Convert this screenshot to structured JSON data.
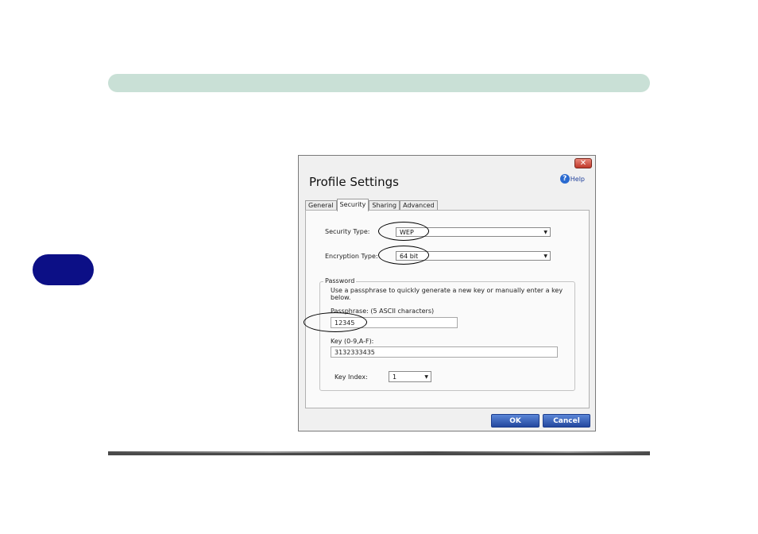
{
  "dialog": {
    "title": "Profile Settings",
    "close_glyph": "✕",
    "help_label": "Help",
    "help_glyph": "?"
  },
  "tabs": [
    {
      "label": "General",
      "active": false
    },
    {
      "label": "Security",
      "active": true
    },
    {
      "label": "Sharing",
      "active": false
    },
    {
      "label": "Advanced",
      "active": false
    }
  ],
  "security": {
    "security_type_label": "Security Type:",
    "security_type_value": "WEP",
    "encryption_type_label": "Encryption Type:",
    "encryption_type_value": "64 bit"
  },
  "password": {
    "group_title": "Password",
    "hint": "Use a passphrase to quickly generate a new key or manually enter a key below.",
    "passphrase_label": "Passphrase: (5 ASCII characters)",
    "passphrase_value": "12345",
    "key_label": "Key (0-9,A-F):",
    "key_value": "3132333435",
    "key_index_label": "Key Index:",
    "key_index_value": "1"
  },
  "buttons": {
    "ok": "OK",
    "cancel": "Cancel"
  },
  "icons": {
    "dropdown": "▼"
  },
  "colors": {
    "header_bar": "#c9e0d6",
    "side_tab": "#0c0f86",
    "button": "#24489e"
  }
}
